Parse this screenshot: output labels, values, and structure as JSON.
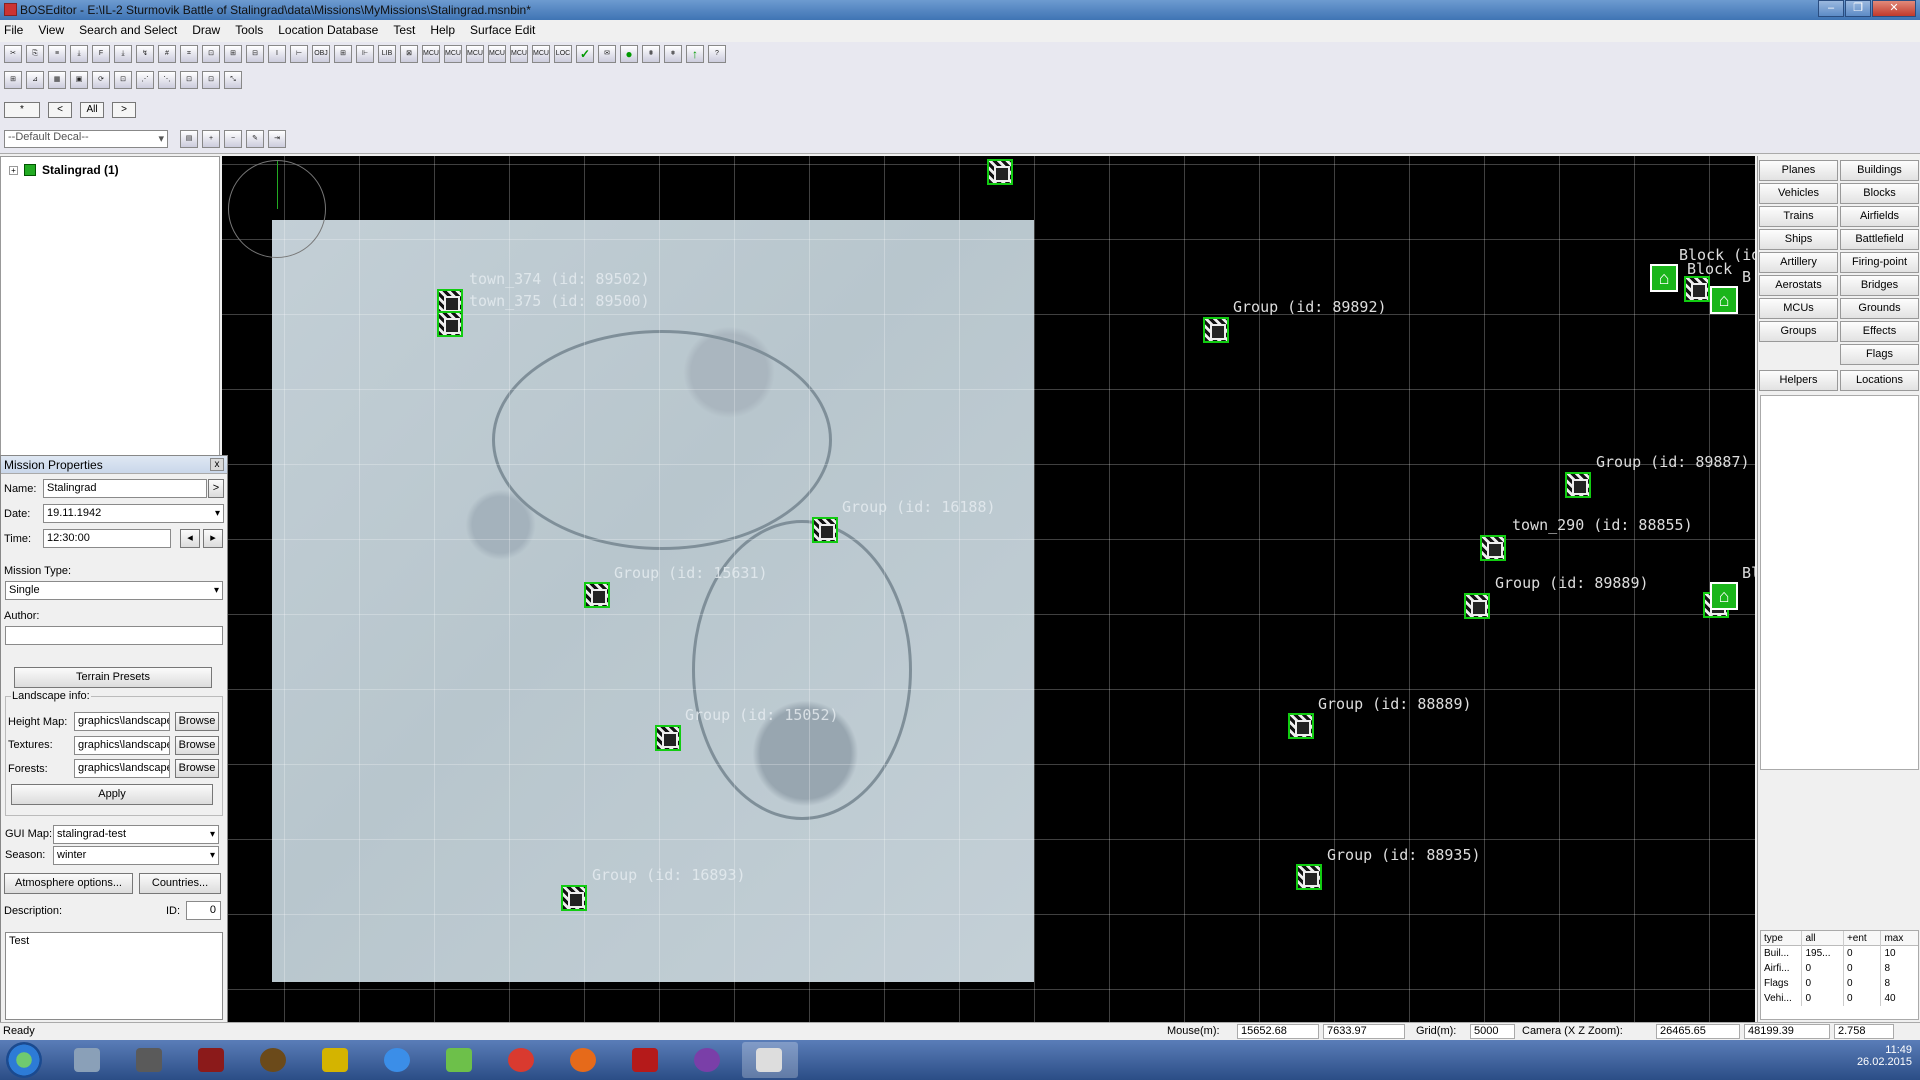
{
  "window": {
    "title": "BOSEditor - E:\\IL-2 Sturmovik Battle of Stalingrad\\data\\Missions\\MyMissions\\Stalingrad.msnbin*"
  },
  "menu": [
    "File",
    "View",
    "Search and Select",
    "Draw",
    "Tools",
    "Location Database",
    "Test",
    "Help",
    "Surface Edit"
  ],
  "toolbar1": [
    "✂",
    "⎘",
    "≡",
    "⤓",
    "F",
    "⤓",
    "↯",
    "#",
    "⌗",
    "⊡",
    "⊞",
    "⊟",
    "I",
    "⊢",
    "OBJ FIX",
    "⊞",
    "⊩",
    "LIB",
    "⊠",
    "MCU OBJ",
    "MCU TAR",
    "MCU MES",
    "MCU SEL",
    "MCU UNSI",
    "MCU ARW",
    "LOC",
    "✓",
    "✉",
    "●",
    "⩩",
    "⩨",
    "↑",
    "?"
  ],
  "toolbar2": [
    "⊞",
    "⊿",
    "▦",
    "▣",
    "⟳",
    "⊡",
    "⋰",
    "⋱",
    "⊡",
    "⊡",
    "⤡"
  ],
  "nav": {
    "marker": "*",
    "prev": "<",
    "all": "All",
    "next": ">"
  },
  "decal": {
    "value": "--Default Decal--"
  },
  "tree": {
    "root": "Stalingrad (1)"
  },
  "map_labels": [
    {
      "text": "town_374 (id: 89502)",
      "dim": true
    },
    {
      "text": "town_375 (id: 89500)",
      "dim": true
    },
    {
      "text": "Group (id: 89892)",
      "dim": false
    },
    {
      "text": "Group (id: 16188)",
      "dim": true
    },
    {
      "text": "Group (id: 15631)",
      "dim": true
    },
    {
      "text": "Group (id: 15052)",
      "dim": true
    },
    {
      "text": "Group (id: 16893)",
      "dim": true
    },
    {
      "text": "Group (id: 89887)",
      "dim": false
    },
    {
      "text": "town_290 (id: 88855)",
      "dim": false
    },
    {
      "text": "Group (id: 89889)",
      "dim": false
    },
    {
      "text": "Group (id: 88889)",
      "dim": false
    },
    {
      "text": "Group (id: 88935)",
      "dim": false
    },
    {
      "text": "Block (id",
      "dim": false
    },
    {
      "text": "Block",
      "dim": false
    },
    {
      "text": "Bl",
      "dim": false
    },
    {
      "text": "B",
      "dim": false
    }
  ],
  "right_buttons": [
    "Planes",
    "Buildings",
    "Vehicles",
    "Blocks",
    "Trains",
    "Airfields",
    "Ships",
    "Battlefield",
    "Artillery",
    "Firing-point",
    "Aerostats",
    "Bridges",
    "MCUs",
    "Grounds",
    "Groups",
    "Effects",
    "Flags",
    "Helpers",
    "Locations"
  ],
  "stats": {
    "headers": [
      "type",
      "all",
      "+ent",
      "max"
    ],
    "rows": [
      [
        "Buil...",
        "195...",
        "0",
        "10"
      ],
      [
        "Airfi...",
        "0",
        "0",
        "8"
      ],
      [
        "Flags",
        "0",
        "0",
        "8"
      ],
      [
        "Vehi...",
        "0",
        "0",
        "40"
      ]
    ]
  },
  "mission": {
    "title": "Mission Properties",
    "close": "x",
    "name_label": "Name:",
    "name_value": "Stalingrad",
    "name_btn": ">",
    "date_label": "Date:",
    "date_value": "19.11.1942",
    "time_label": "Time:",
    "time_value": "12:30:00",
    "type_label": "Mission Type:",
    "type_value": "Single",
    "author_label": "Author:",
    "author_value": "",
    "terrain_presets": "Terrain Presets",
    "landscape_label": "Landscape info:",
    "heightmap_label": "Height Map:",
    "heightmap_value": "graphics\\landscape",
    "textures_label": "Textures:",
    "textures_value": "graphics\\landscape",
    "forests_label": "Forests:",
    "forests_value": "graphics\\landscape",
    "browse": "Browse",
    "apply": "Apply",
    "guimap_label": "GUI Map:",
    "guimap_value": "stalingrad-test",
    "season_label": "Season:",
    "season_value": "winter",
    "atmosphere": "Atmosphere options...",
    "countries": "Countries...",
    "desc_label": "Description:",
    "id_label": "ID:",
    "id_value": "0",
    "desc_value": "Test"
  },
  "status": {
    "ready": "Ready",
    "mouse_label": "Mouse(m):",
    "mouse_x": "15652.68",
    "mouse_z": "7633.97",
    "grid_label": "Grid(m):",
    "grid_value": "5000",
    "camera_label": "Camera (X Z Zoom):",
    "cam_x": "26465.65",
    "cam_z": "48199.39",
    "cam_zoom": "2.758"
  },
  "taskbar": {
    "time": "11:49",
    "date": "26.02.2015"
  },
  "colors": {
    "map_bg": "#000000",
    "marker_green": "#11cc11",
    "house_green": "#1ab51a"
  }
}
